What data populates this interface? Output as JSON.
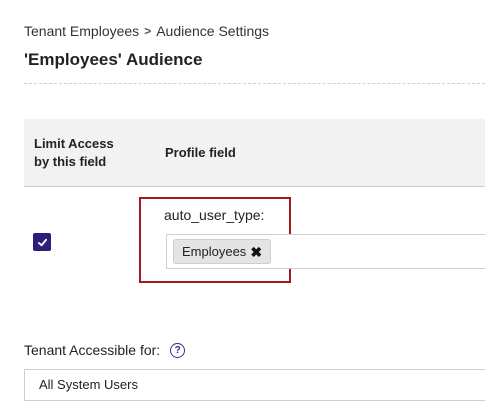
{
  "breadcrumb": {
    "parent": "Tenant Employees",
    "separator": ">",
    "current": "Audience Settings"
  },
  "page_title": "'Employees' Audience",
  "table": {
    "headers": {
      "limit_access": "Limit Access by this field",
      "profile_field": "Profile field"
    },
    "rows": [
      {
        "limit_access_checked": true,
        "field_name": "auto_user_type:",
        "tags": [
          {
            "label": "Employees",
            "remove_icon": "✖"
          }
        ]
      }
    ]
  },
  "tenant_accessible": {
    "label": "Tenant Accessible for:",
    "help_icon": "?",
    "selected": "All System Users"
  },
  "colors": {
    "accent": "#2c1f7a",
    "highlight": "#a01c1c",
    "header_bg": "#f2f2f2"
  }
}
